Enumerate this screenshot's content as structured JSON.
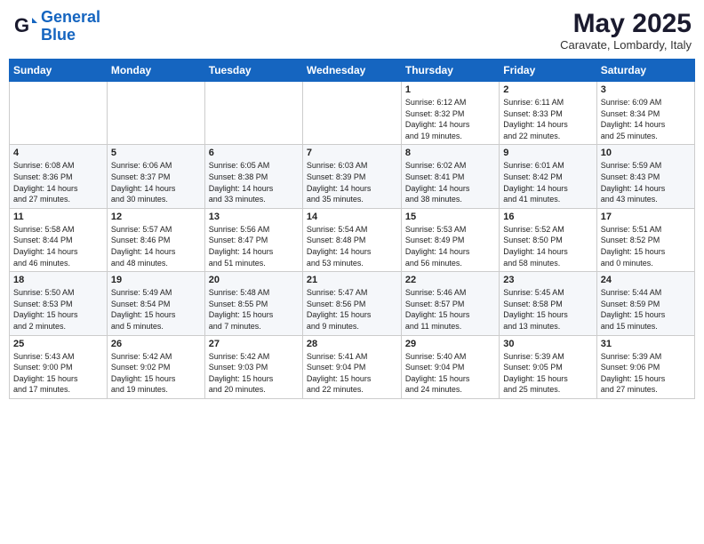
{
  "logo": {
    "line1": "General",
    "line2": "Blue"
  },
  "title": "May 2025",
  "subtitle": "Caravate, Lombardy, Italy",
  "weekdays": [
    "Sunday",
    "Monday",
    "Tuesday",
    "Wednesday",
    "Thursday",
    "Friday",
    "Saturday"
  ],
  "weeks": [
    [
      {
        "day": "",
        "info": ""
      },
      {
        "day": "",
        "info": ""
      },
      {
        "day": "",
        "info": ""
      },
      {
        "day": "",
        "info": ""
      },
      {
        "day": "1",
        "info": "Sunrise: 6:12 AM\nSunset: 8:32 PM\nDaylight: 14 hours\nand 19 minutes."
      },
      {
        "day": "2",
        "info": "Sunrise: 6:11 AM\nSunset: 8:33 PM\nDaylight: 14 hours\nand 22 minutes."
      },
      {
        "day": "3",
        "info": "Sunrise: 6:09 AM\nSunset: 8:34 PM\nDaylight: 14 hours\nand 25 minutes."
      }
    ],
    [
      {
        "day": "4",
        "info": "Sunrise: 6:08 AM\nSunset: 8:36 PM\nDaylight: 14 hours\nand 27 minutes."
      },
      {
        "day": "5",
        "info": "Sunrise: 6:06 AM\nSunset: 8:37 PM\nDaylight: 14 hours\nand 30 minutes."
      },
      {
        "day": "6",
        "info": "Sunrise: 6:05 AM\nSunset: 8:38 PM\nDaylight: 14 hours\nand 33 minutes."
      },
      {
        "day": "7",
        "info": "Sunrise: 6:03 AM\nSunset: 8:39 PM\nDaylight: 14 hours\nand 35 minutes."
      },
      {
        "day": "8",
        "info": "Sunrise: 6:02 AM\nSunset: 8:41 PM\nDaylight: 14 hours\nand 38 minutes."
      },
      {
        "day": "9",
        "info": "Sunrise: 6:01 AM\nSunset: 8:42 PM\nDaylight: 14 hours\nand 41 minutes."
      },
      {
        "day": "10",
        "info": "Sunrise: 5:59 AM\nSunset: 8:43 PM\nDaylight: 14 hours\nand 43 minutes."
      }
    ],
    [
      {
        "day": "11",
        "info": "Sunrise: 5:58 AM\nSunset: 8:44 PM\nDaylight: 14 hours\nand 46 minutes."
      },
      {
        "day": "12",
        "info": "Sunrise: 5:57 AM\nSunset: 8:46 PM\nDaylight: 14 hours\nand 48 minutes."
      },
      {
        "day": "13",
        "info": "Sunrise: 5:56 AM\nSunset: 8:47 PM\nDaylight: 14 hours\nand 51 minutes."
      },
      {
        "day": "14",
        "info": "Sunrise: 5:54 AM\nSunset: 8:48 PM\nDaylight: 14 hours\nand 53 minutes."
      },
      {
        "day": "15",
        "info": "Sunrise: 5:53 AM\nSunset: 8:49 PM\nDaylight: 14 hours\nand 56 minutes."
      },
      {
        "day": "16",
        "info": "Sunrise: 5:52 AM\nSunset: 8:50 PM\nDaylight: 14 hours\nand 58 minutes."
      },
      {
        "day": "17",
        "info": "Sunrise: 5:51 AM\nSunset: 8:52 PM\nDaylight: 15 hours\nand 0 minutes."
      }
    ],
    [
      {
        "day": "18",
        "info": "Sunrise: 5:50 AM\nSunset: 8:53 PM\nDaylight: 15 hours\nand 2 minutes."
      },
      {
        "day": "19",
        "info": "Sunrise: 5:49 AM\nSunset: 8:54 PM\nDaylight: 15 hours\nand 5 minutes."
      },
      {
        "day": "20",
        "info": "Sunrise: 5:48 AM\nSunset: 8:55 PM\nDaylight: 15 hours\nand 7 minutes."
      },
      {
        "day": "21",
        "info": "Sunrise: 5:47 AM\nSunset: 8:56 PM\nDaylight: 15 hours\nand 9 minutes."
      },
      {
        "day": "22",
        "info": "Sunrise: 5:46 AM\nSunset: 8:57 PM\nDaylight: 15 hours\nand 11 minutes."
      },
      {
        "day": "23",
        "info": "Sunrise: 5:45 AM\nSunset: 8:58 PM\nDaylight: 15 hours\nand 13 minutes."
      },
      {
        "day": "24",
        "info": "Sunrise: 5:44 AM\nSunset: 8:59 PM\nDaylight: 15 hours\nand 15 minutes."
      }
    ],
    [
      {
        "day": "25",
        "info": "Sunrise: 5:43 AM\nSunset: 9:00 PM\nDaylight: 15 hours\nand 17 minutes."
      },
      {
        "day": "26",
        "info": "Sunrise: 5:42 AM\nSunset: 9:02 PM\nDaylight: 15 hours\nand 19 minutes."
      },
      {
        "day": "27",
        "info": "Sunrise: 5:42 AM\nSunset: 9:03 PM\nDaylight: 15 hours\nand 20 minutes."
      },
      {
        "day": "28",
        "info": "Sunrise: 5:41 AM\nSunset: 9:04 PM\nDaylight: 15 hours\nand 22 minutes."
      },
      {
        "day": "29",
        "info": "Sunrise: 5:40 AM\nSunset: 9:04 PM\nDaylight: 15 hours\nand 24 minutes."
      },
      {
        "day": "30",
        "info": "Sunrise: 5:39 AM\nSunset: 9:05 PM\nDaylight: 15 hours\nand 25 minutes."
      },
      {
        "day": "31",
        "info": "Sunrise: 5:39 AM\nSunset: 9:06 PM\nDaylight: 15 hours\nand 27 minutes."
      }
    ]
  ]
}
